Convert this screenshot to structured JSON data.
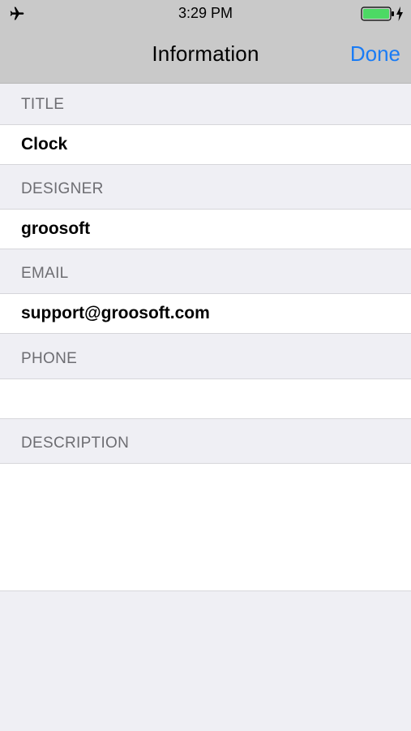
{
  "status_bar": {
    "time": "3:29 PM",
    "left_icon": "airplane-icon",
    "right_icons": [
      "battery-icon",
      "charging-icon"
    ],
    "battery_color": "#4cd964"
  },
  "nav": {
    "title": "Information",
    "done_label": "Done",
    "accent_color": "#1a7cf5"
  },
  "form": {
    "title": {
      "label": "TITLE",
      "value": "Clock"
    },
    "designer": {
      "label": "DESIGNER",
      "value": "groosoft"
    },
    "email": {
      "label": "EMAIL",
      "value": "support@groosoft.com"
    },
    "phone": {
      "label": "PHONE",
      "value": ""
    },
    "description": {
      "label": "DESCRIPTION",
      "value": ""
    }
  }
}
